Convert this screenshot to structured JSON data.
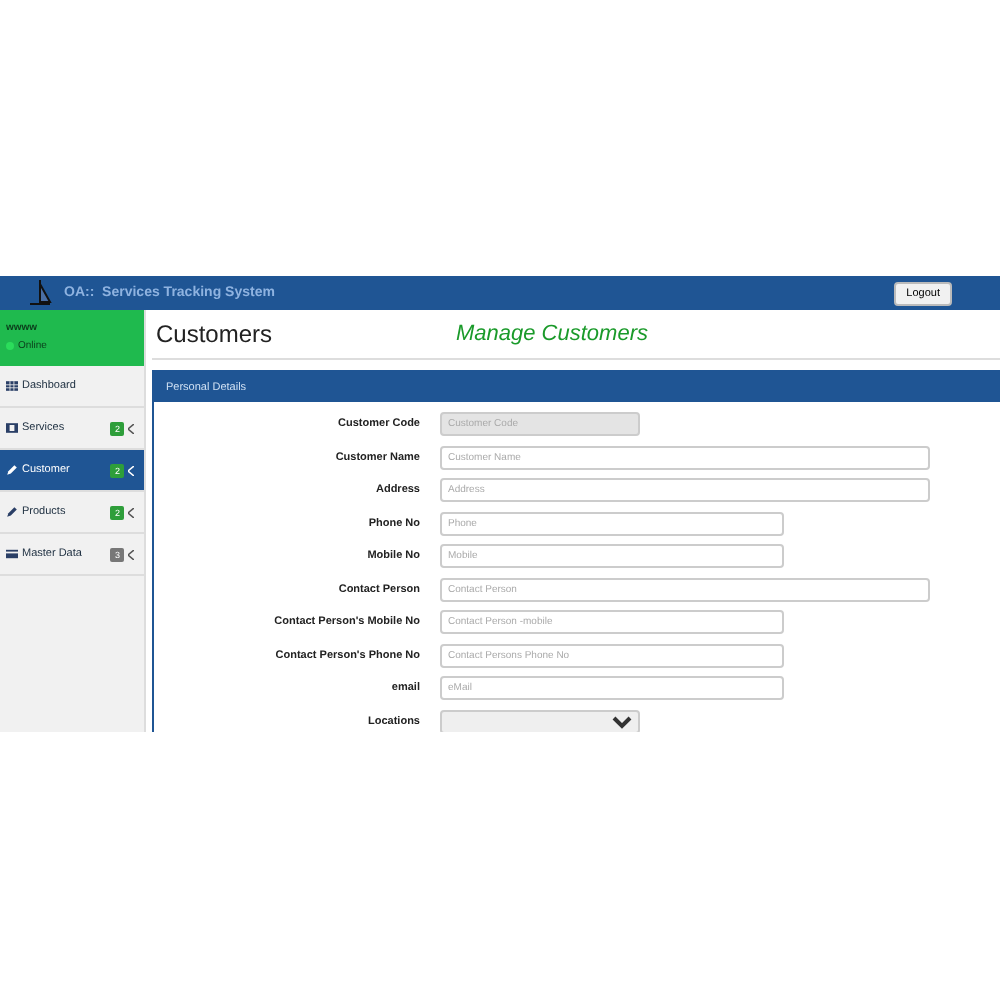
{
  "header": {
    "title": "OA::  Services Tracking System",
    "logout": "Logout"
  },
  "user": {
    "name": "wwww",
    "status": "Online"
  },
  "sidebar": {
    "items": [
      {
        "label": "Dashboard",
        "selected": false
      },
      {
        "label": "Services",
        "selected": false,
        "badge": "2",
        "color": "#2e9e3a"
      },
      {
        "label": "Customer",
        "selected": true,
        "badge": "2",
        "color": "#2e9e3a"
      },
      {
        "label": "Products",
        "selected": false,
        "badge": "2",
        "color": "#2e9e3a"
      },
      {
        "label": "Master Data",
        "selected": false,
        "badge": "3",
        "color": "#777777"
      }
    ]
  },
  "page": {
    "title": "Customers",
    "subtitle": "Manage Customers"
  },
  "panel": {
    "title": "Personal Details",
    "fields": [
      {
        "label": "Customer Code",
        "placeholder": "Customer Code",
        "disabled": true
      },
      {
        "label": "Customer Name",
        "placeholder": "Customer Name",
        "disabled": false
      },
      {
        "label": "Address",
        "placeholder": "Address",
        "disabled": false
      },
      {
        "label": "Phone No",
        "placeholder": "Phone",
        "disabled": false
      },
      {
        "label": "Mobile No",
        "placeholder": "Mobile",
        "disabled": false
      },
      {
        "label": "Contact Person",
        "placeholder": "Contact Person",
        "disabled": false
      },
      {
        "label": "Contact Person's Mobile No",
        "placeholder": "Contact Person -mobile",
        "disabled": false
      },
      {
        "label": "Contact Person's Phone No",
        "placeholder": "Contact Persons Phone No",
        "disabled": false
      },
      {
        "label": "email",
        "placeholder": "eMail",
        "disabled": false
      },
      {
        "label": "Locations",
        "disabled": false,
        "kind": "select"
      }
    ]
  }
}
